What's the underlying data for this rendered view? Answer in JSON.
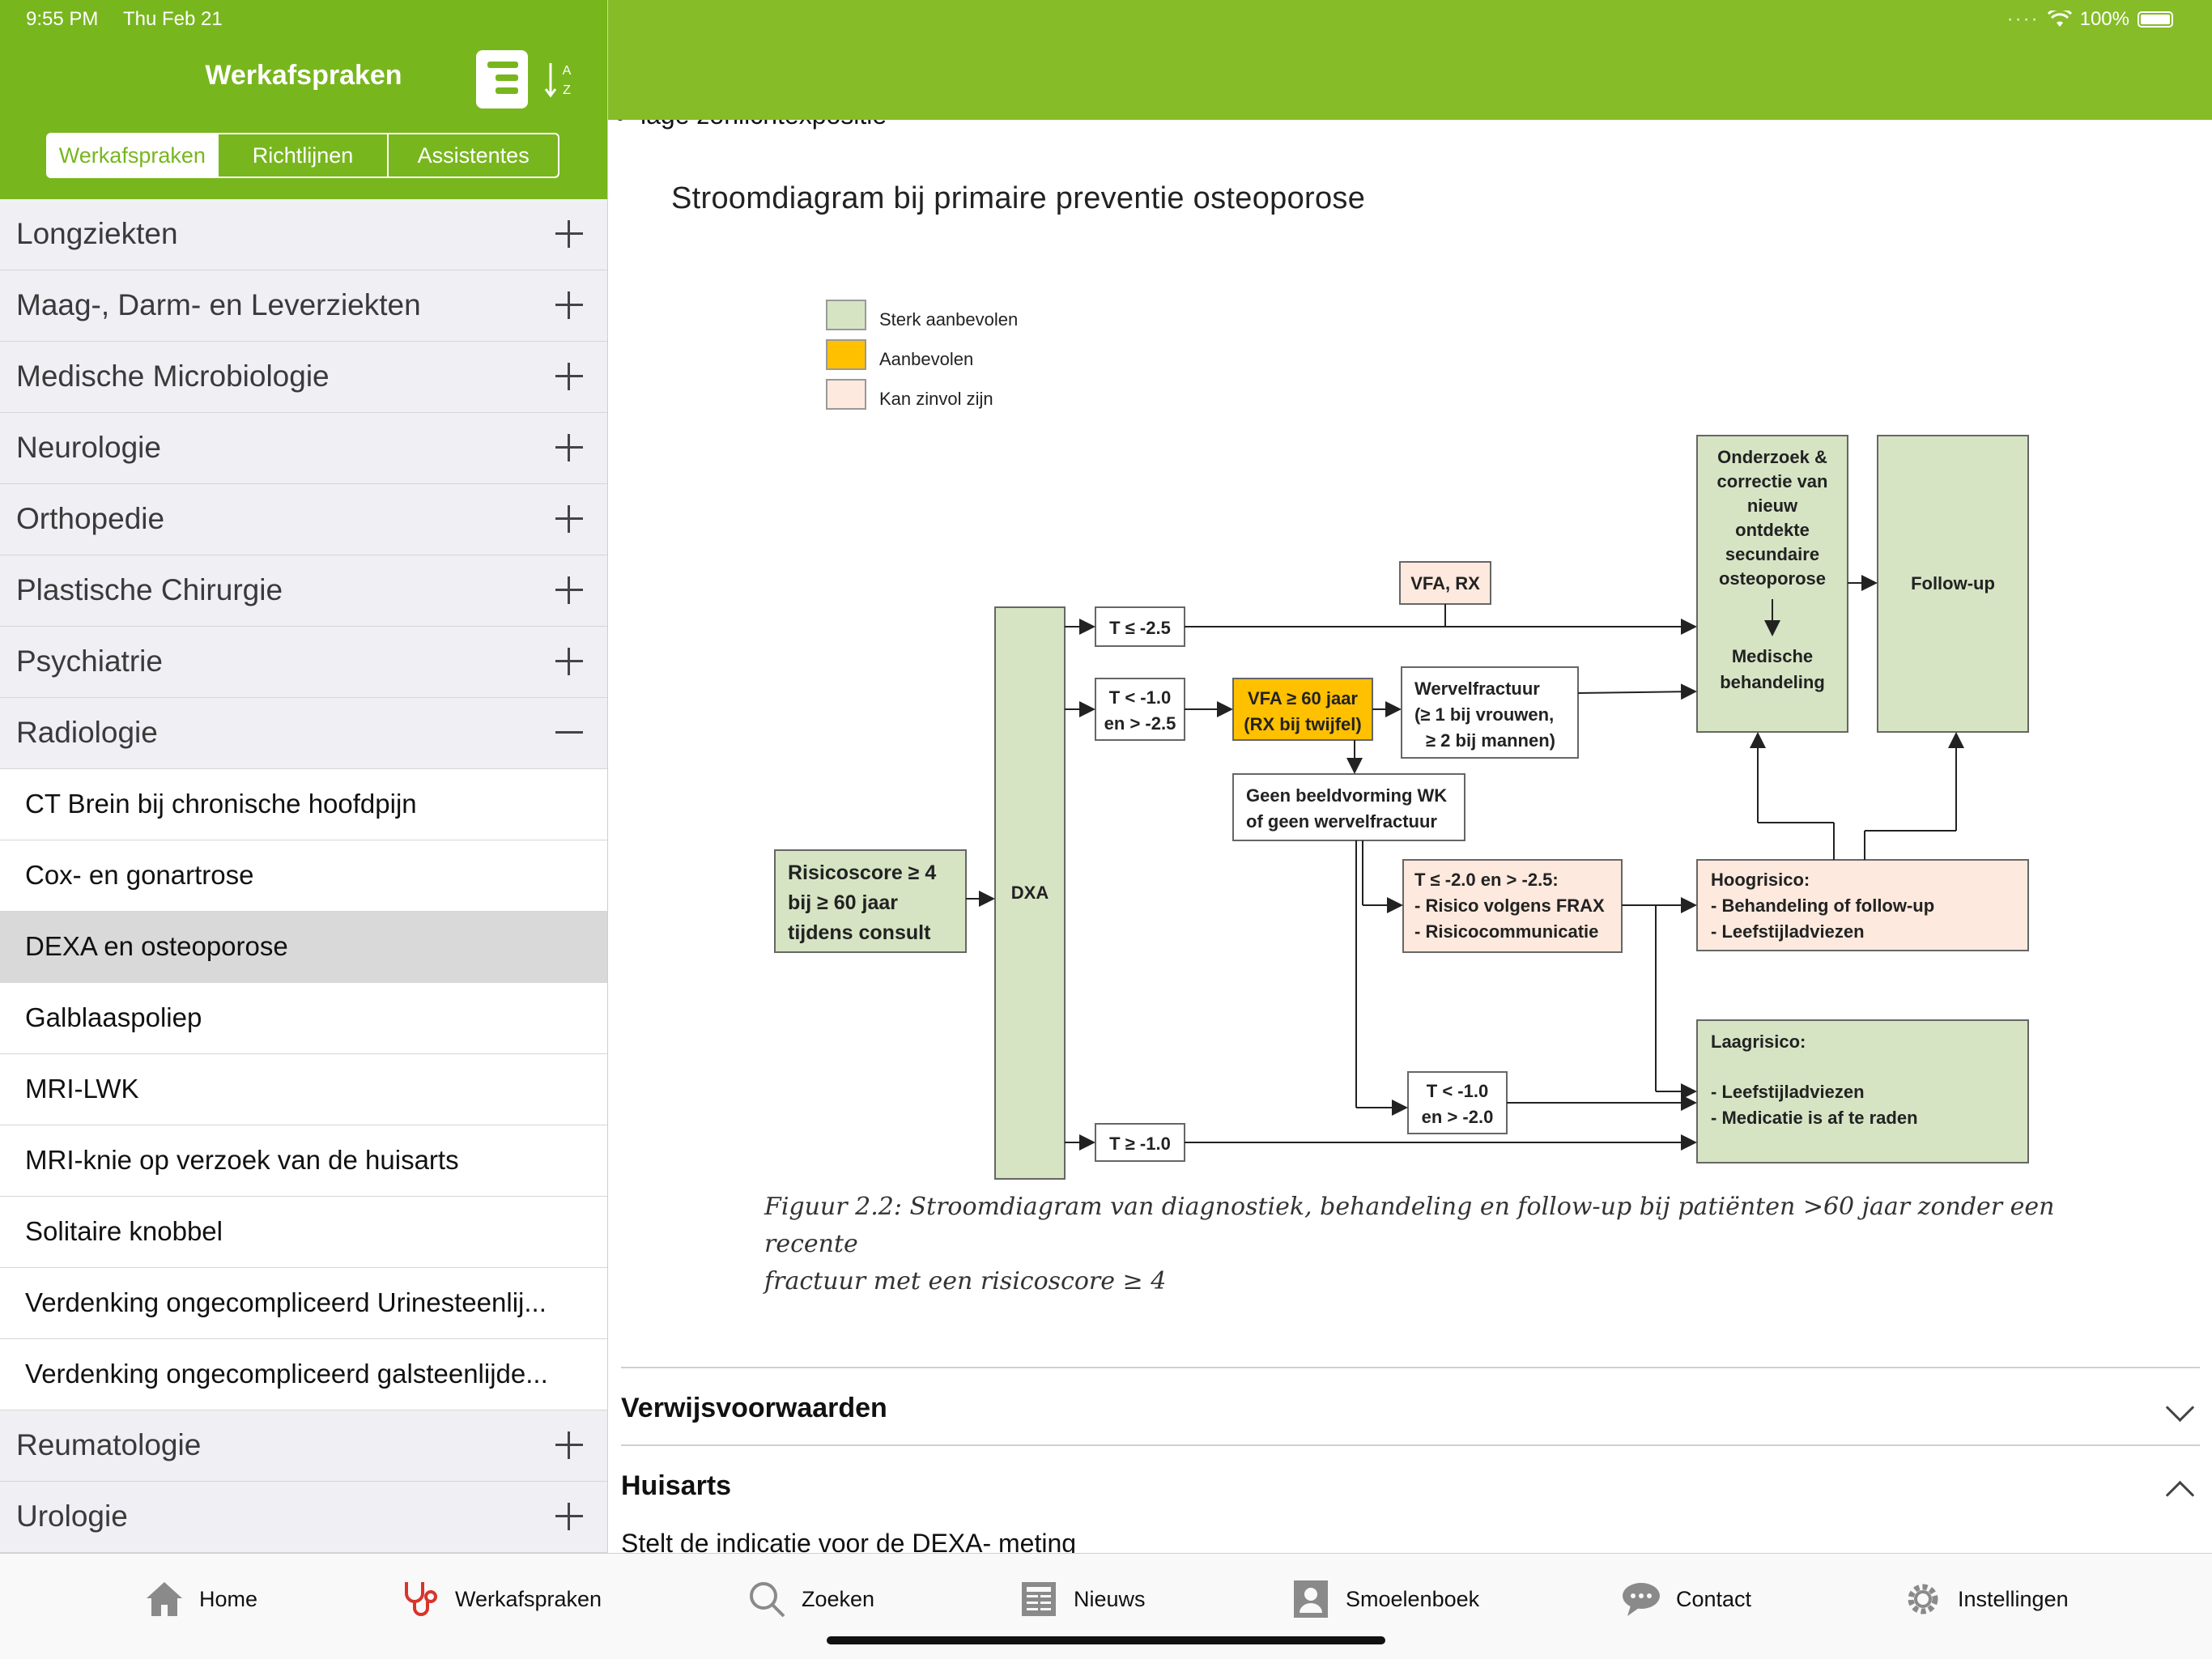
{
  "status": {
    "time": "9:55 PM",
    "date": "Thu Feb 21",
    "battery": "100%"
  },
  "sidebar": {
    "title": "Werkafspraken",
    "segments": [
      "Werkafspraken",
      "Richtlijnen",
      "Assistentes"
    ],
    "categories_top": [
      "Longziekten",
      "Maag-, Darm- en Leverziekten",
      "Medische Microbiologie",
      "Neurologie",
      "Orthopedie",
      "Plastische Chirurgie",
      "Psychiatrie",
      "Radiologie"
    ],
    "radiologie_items": [
      "CT Brein bij chronische hoofdpijn",
      "Cox- en gonartrose",
      "DEXA en osteoporose",
      "Galblaaspoliep",
      "MRI-LWK",
      "MRI-knie op verzoek van de huisarts",
      "Solitaire knobbel",
      "Verdenking ongecompliceerd Urinesteenlij...",
      "Verdenking ongecompliceerd galsteenlijde..."
    ],
    "categories_bottom": [
      "Reumatologie",
      "Urologie"
    ]
  },
  "content": {
    "bullet_text": "lage zonlichtexpositie",
    "figure_title": "Stroomdiagram bij primaire preventie osteoporose",
    "legend": [
      "Sterk aanbevolen",
      "Aanbevolen",
      "Kan zinvol zijn"
    ],
    "colors": {
      "green": "#d6e4c4",
      "yellow": "#ffc000",
      "peach": "#fde9dd",
      "brand": "#78b61e"
    },
    "diagram": {
      "risk": [
        "Risicoscore ≥ 4",
        "bij ≥ 60 jaar",
        "tijdens consult"
      ],
      "dxa": "DXA",
      "t1": "T ≤ -2.5",
      "t2": [
        "T < -1.0",
        "en > -2.5"
      ],
      "t3": "T ≥ -1.0",
      "vfa60": [
        "VFA ≥ 60 jaar",
        "(RX bij twijfel)"
      ],
      "wervel": [
        "Wervelfractuur",
        "(≥ 1 bij vrouwen,",
        "≥ 2 bij mannen)"
      ],
      "vfarx": "VFA, RX",
      "geen": [
        "Geen beeldvorming WK",
        "of geen wervelfractuur"
      ],
      "t4": [
        "T ≤ -2.0 en > -2.5:",
        "- Risico volgens FRAX",
        "- Risicocommunicatie"
      ],
      "t5": [
        "T < -1.0",
        "en > -2.0"
      ],
      "onderzoek": [
        "Onderzoek &",
        "correctie van",
        "nieuw",
        "ontdekte",
        "secundaire",
        "osteoporose"
      ],
      "medische": [
        "Medische",
        "behandeling"
      ],
      "followup": "Follow-up",
      "hoog": [
        "Hoogrisico:",
        "- Behandeling of follow-up",
        "- Leefstijladviezen"
      ],
      "laag": [
        "Laagrisico:",
        "- Leefstijladviezen",
        "- Medicatie is af te raden"
      ]
    },
    "caption_line1": "Figuur 2.2: Stroomdiagram van diagnostiek, behandeling en follow-up bij patiënten >60 jaar zonder een recente",
    "caption_line2": "fractuur met een risicoscore ≥ 4",
    "accordions": [
      "Verwijsvoorwaarden",
      "Huisarts"
    ],
    "cut_text": "Stelt de indicatie voor de DEXA- meting"
  },
  "tabs": [
    "Home",
    "Werkafspraken",
    "Zoeken",
    "Nieuws",
    "Smoelenboek",
    "Contact",
    "Instellingen"
  ]
}
